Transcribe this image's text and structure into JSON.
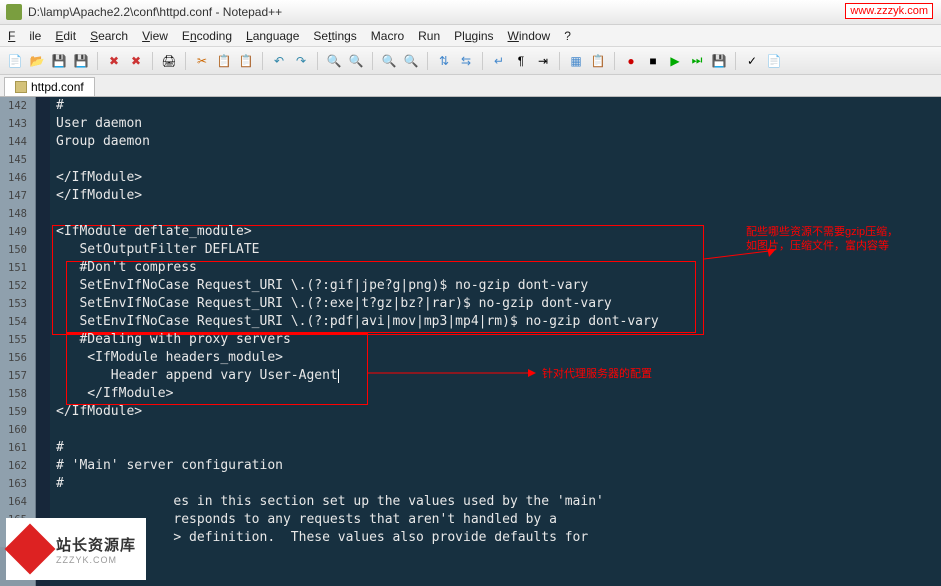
{
  "titlebar": {
    "path": "D:\\lamp\\Apache2.2\\conf\\httpd.conf - Notepad++"
  },
  "watermark_top": "www.zzzyk.com",
  "menu": {
    "file": "File",
    "edit": "Edit",
    "search": "Search",
    "view": "View",
    "encoding": "Encoding",
    "language": "Language",
    "settings": "Settings",
    "macro": "Macro",
    "run": "Run",
    "plugins": "Plugins",
    "window": "Window",
    "help": "?"
  },
  "tab": {
    "name": "httpd.conf"
  },
  "lines": [
    {
      "n": 142,
      "t": "#"
    },
    {
      "n": 143,
      "t": "User daemon"
    },
    {
      "n": 144,
      "t": "Group daemon"
    },
    {
      "n": 145,
      "t": " "
    },
    {
      "n": 146,
      "t": "</IfModule>"
    },
    {
      "n": 147,
      "t": "</IfModule>"
    },
    {
      "n": 148,
      "t": " "
    },
    {
      "n": 149,
      "t": "<IfModule deflate_module>"
    },
    {
      "n": 150,
      "t": "   SetOutputFilter DEFLATE"
    },
    {
      "n": 151,
      "t": "   #Don't compress"
    },
    {
      "n": 152,
      "t": "   SetEnvIfNoCase Request_URI \\.(?:gif|jpe?g|png)$ no-gzip dont-vary"
    },
    {
      "n": 153,
      "t": "   SetEnvIfNoCase Request_URI \\.(?:exe|t?gz|bz?|rar)$ no-gzip dont-vary"
    },
    {
      "n": 154,
      "t": "   SetEnvIfNoCase Request_URI \\.(?:pdf|avi|mov|mp3|mp4|rm)$ no-gzip dont-vary"
    },
    {
      "n": 155,
      "t": "   #Dealing with proxy servers"
    },
    {
      "n": 156,
      "t": "    <IfModule headers_module>"
    },
    {
      "n": 157,
      "t": "       Header append vary User-Agent"
    },
    {
      "n": 158,
      "t": "    </IfModule>"
    },
    {
      "n": 159,
      "t": "</IfModule>"
    },
    {
      "n": 160,
      "t": " "
    },
    {
      "n": 161,
      "t": "#"
    },
    {
      "n": 162,
      "t": "# 'Main' server configuration"
    },
    {
      "n": 163,
      "t": "#"
    },
    {
      "n": 164,
      "t": "               es in this section set up the values used by the 'main'"
    },
    {
      "n": 165,
      "t": "               responds to any requests that aren't handled by a"
    },
    {
      "n": 166,
      "t": "               > definition.  These values also provide defaults for"
    }
  ],
  "annot": {
    "a1": "配些哪些资源不需要gzip压缩，\n如图片，压缩文件，富内容等",
    "a2": "针对代理服务器的配置"
  },
  "wm_bottom": {
    "title": "站长资源库",
    "domain": "ZZZYK.COM"
  }
}
